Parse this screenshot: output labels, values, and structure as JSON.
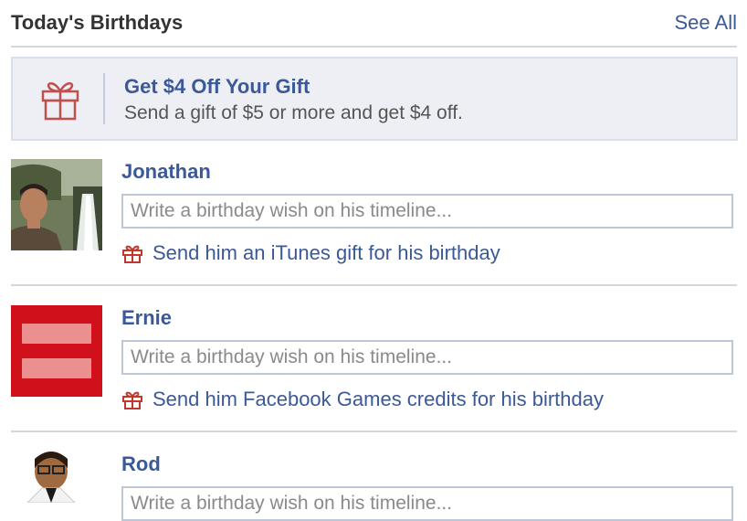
{
  "header": {
    "title": "Today's Birthdays",
    "see_all": "See All"
  },
  "promo": {
    "icon": "gift-icon",
    "title": "Get $4 Off Your Gift",
    "subtitle": "Send a gift of $5 or more and get $4 off."
  },
  "birthdays": [
    {
      "name": "Jonathan",
      "wish_placeholder": "Write a birthday wish on his timeline...",
      "gift_text": "Send him an iTunes gift for his birthday"
    },
    {
      "name": "Ernie",
      "wish_placeholder": "Write a birthday wish on his timeline...",
      "gift_text": "Send him Facebook Games credits for his birthday"
    },
    {
      "name": "Rod",
      "wish_placeholder": "Write a birthday wish on his timeline..."
    }
  ],
  "colors": {
    "link": "#3b5998",
    "gift_icon": "#c0392b",
    "promo_bg": "#edeff4",
    "equality_red": "#d0101a"
  }
}
